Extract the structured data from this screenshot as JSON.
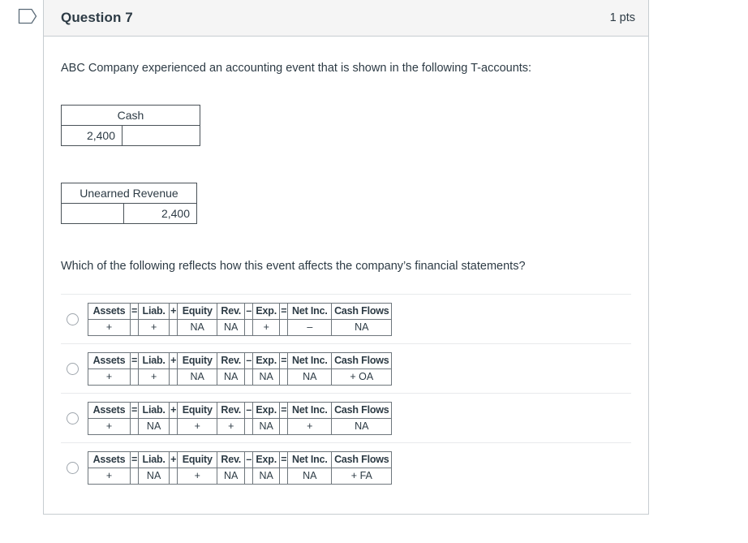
{
  "flag": {
    "icon": "flag-tag-outline-icon"
  },
  "header": {
    "title": "Question 7",
    "points": "1 pts"
  },
  "body": {
    "intro_text": "ABC Company experienced an accounting event that is shown in the following T-accounts:",
    "question_text": "Which of the following reflects how this event affects the company’s financial statements?"
  },
  "t_accounts": [
    {
      "title": "Cash",
      "debit": "2,400",
      "credit": ""
    },
    {
      "title": "Unearned Revenue",
      "debit": "",
      "credit": "2,400"
    }
  ],
  "answer_table_headers": {
    "assets": "Assets",
    "eq1": "=",
    "liab": "Liab.",
    "plus1": "+",
    "equity": "Equity",
    "rev": "Rev.",
    "minus": "–",
    "exp": "Exp.",
    "eq2": "=",
    "net_inc": "Net Inc.",
    "cash_flows": "Cash Flows"
  },
  "answers": [
    {
      "selected": false,
      "assets": "+",
      "liab": "+",
      "equity": "NA",
      "rev": "NA",
      "exp": "+",
      "net_inc": "–",
      "cash_flows": "NA"
    },
    {
      "selected": false,
      "assets": "+",
      "liab": "+",
      "equity": "NA",
      "rev": "NA",
      "exp": "NA",
      "net_inc": "NA",
      "cash_flows": "+ OA"
    },
    {
      "selected": false,
      "assets": "+",
      "liab": "NA",
      "equity": "+",
      "rev": "+",
      "exp": "NA",
      "net_inc": "+",
      "cash_flows": "NA"
    },
    {
      "selected": false,
      "assets": "+",
      "liab": "NA",
      "equity": "+",
      "rev": "NA",
      "exp": "NA",
      "net_inc": "NA",
      "cash_flows": "+ FA"
    }
  ],
  "colors": {
    "header_bg": "#f5f5f5",
    "card_border": "#c7cdd1",
    "text": "#2d3b45",
    "table_border": "#4a5258",
    "divider": "#e8eaec"
  }
}
